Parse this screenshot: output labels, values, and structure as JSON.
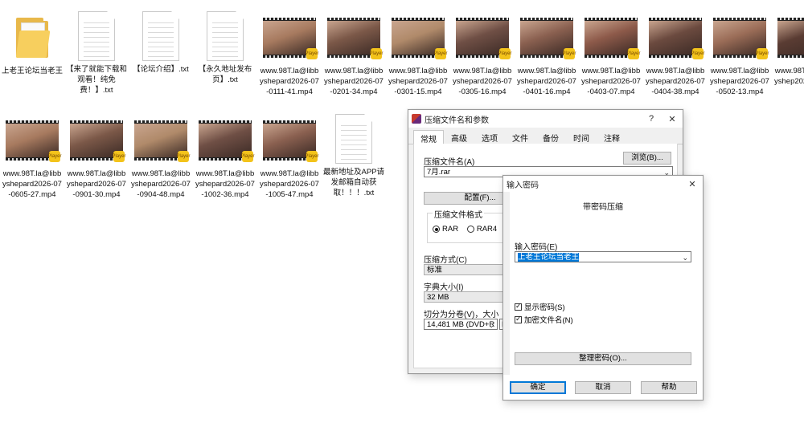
{
  "desktop": {
    "row1": [
      {
        "kind": "folder",
        "label": "上老王论坛当老王"
      },
      {
        "kind": "doc",
        "label": "【来了就能下载和观看！纯免费！】.txt"
      },
      {
        "kind": "doc",
        "label": "【论坛介绍】.txt"
      },
      {
        "kind": "doc",
        "label": "【永久地址发布页】.txt"
      },
      {
        "kind": "video",
        "label": "www.98T.la@libbyshepard2026-07-0111-41.mp4"
      },
      {
        "kind": "video",
        "label": "www.98T.la@libbyshepard2026-07-0201-34.mp4"
      },
      {
        "kind": "video",
        "label": "www.98T.la@libbyshepard2026-07-0301-15.mp4"
      },
      {
        "kind": "video",
        "label": "www.98T.la@libbyshepard2026-07-0305-16.mp4"
      },
      {
        "kind": "video",
        "label": "www.98T.la@libbyshepard2026-07-0401-16.mp4"
      },
      {
        "kind": "video",
        "label": "www.98T.la@libbyshepard2026-07-0403-07.mp4"
      },
      {
        "kind": "video",
        "label": "www.98T.la@libbyshepard2026-07-0404-38.mp4"
      },
      {
        "kind": "video",
        "label": "www.98T.la@libbyshepard2026-07-0502-13.mp4"
      },
      {
        "kind": "video",
        "label": "www.98T.la@libbyshep2026-07-05"
      }
    ],
    "row2": [
      {
        "kind": "video",
        "label": "www.98T.la@libbyshepard2026-07-0605-27.mp4"
      },
      {
        "kind": "video",
        "label": "www.98T.la@libbyshepard2026-07-0901-30.mp4"
      },
      {
        "kind": "video",
        "label": "www.98T.la@libbyshepard2026-07-0904-48.mp4"
      },
      {
        "kind": "video",
        "label": "www.98T.la@libbyshepard2026-07-1002-36.mp4"
      },
      {
        "kind": "video",
        "label": "www.98T.la@libbyshepard2026-07-1005-47.mp4"
      },
      {
        "kind": "doc",
        "label": "最新地址及APP请发邮箱自动获取！！！.txt"
      }
    ],
    "badge_text": "Player"
  },
  "archive_dialog": {
    "title": "压缩文件名和参数",
    "help": "?",
    "close": "✕",
    "tabs": [
      "常规",
      "高级",
      "选项",
      "文件",
      "备份",
      "时间",
      "注释"
    ],
    "archive_name_label": "压缩文件名(A)",
    "browse_button": "浏览(B)...",
    "archive_name_value": "7月.rar",
    "profiles_button": "配置(F)...",
    "format_label": "压缩文件格式",
    "format_options": [
      "RAR",
      "RAR4",
      "Z"
    ],
    "method_label": "压缩方式(C)",
    "method_value": "标准",
    "dict_label": "字典大小(I)",
    "dict_value": "32 MB",
    "split_label": "切分为分卷(V)，大小",
    "split_value": "14,481 MB  (DVD+R",
    "split_unit": "M"
  },
  "password_dialog": {
    "title": "输入密码",
    "close": "✕",
    "heading": "带密码压缩",
    "password_label": "输入密码(E)",
    "password_value": "上老王论坛当老王",
    "show_password": "显示密码(S)",
    "encrypt_names": "加密文件名(N)",
    "organize_button": "整理密码(O)...",
    "ok_button": "确定",
    "cancel_button": "取消",
    "help_button": "帮助"
  },
  "colors": {
    "accent": "#0078d7",
    "selection": "#0078d7"
  }
}
